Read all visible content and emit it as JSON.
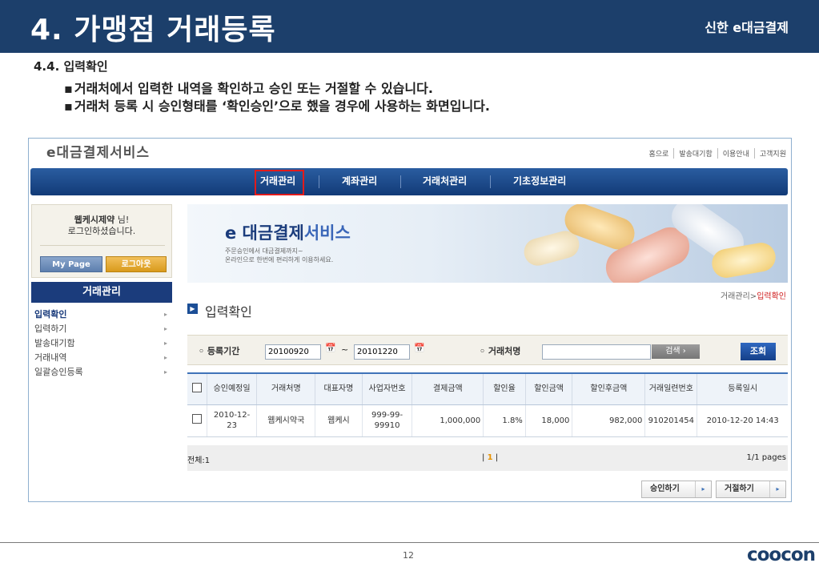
{
  "slide": {
    "title": "4. 가맹점 거래등록",
    "brand": "신한 e대금결제",
    "section": "4.4. 입력확인",
    "bullets": [
      "거래처에서 입력한 내역을 확인하고 승인 또는 거절할 수 있습니다.",
      "거래처 등록 시 승인형태를 ‘확인승인’으로 했을 경우에 사용하는 화면입니다."
    ],
    "page_number": "12",
    "footer_logo": "coocon"
  },
  "app": {
    "logo": "e대금결제서비스",
    "top_links": [
      "홈으로",
      "발송대기함",
      "이용안내",
      "고객지원"
    ],
    "nav": [
      "거래관리",
      "계좌관리",
      "거래처관리",
      "기초정보관리"
    ],
    "login": {
      "user": "웹케시제약",
      "suffix": " 님!",
      "message": "로그인하셨습니다.",
      "mypage": "My Page",
      "logout": "로그아웃"
    },
    "sidebar": {
      "title": "거래관리",
      "items": [
        "입력확인",
        "입력하기",
        "발송대기함",
        "거래내역",
        "일괄승인등록"
      ]
    },
    "banner": {
      "e": "e",
      "title": " 대금결제",
      "title2": "서비스",
      "line1": "주문승인에서 대금결제까지~",
      "line2": "온라인으로 한번에 편리하게 이용하세요."
    },
    "breadcrumb": {
      "parent": "거래관리",
      "sep": ">",
      "current": "입력확인"
    },
    "page_title": "입력확인",
    "search": {
      "period_label": "등록기간",
      "from": "20100920",
      "tilde": "~",
      "to": "20101220",
      "partner_label": "거래처명",
      "partner_value": "",
      "search_button": "검색",
      "lookup_button": "조회"
    },
    "table": {
      "headers": [
        "승인예정일",
        "거래처명",
        "대표자명",
        "사업자번호",
        "결제금액",
        "할인율",
        "할인금액",
        "할인후금액",
        "거래일련번호",
        "등록일시"
      ],
      "rows": [
        [
          "2010-12-23",
          "웹케시약국",
          "웹케시",
          "999-99-99910",
          "1,000,000",
          "1.8%",
          "18,000",
          "982,000",
          "910201454",
          "2010-12-20 14:43"
        ]
      ]
    },
    "footer": {
      "total": "전체:1",
      "page_current": "1",
      "pages": "1/1 pages"
    },
    "actions": [
      "승인하기",
      "거절하기"
    ]
  }
}
